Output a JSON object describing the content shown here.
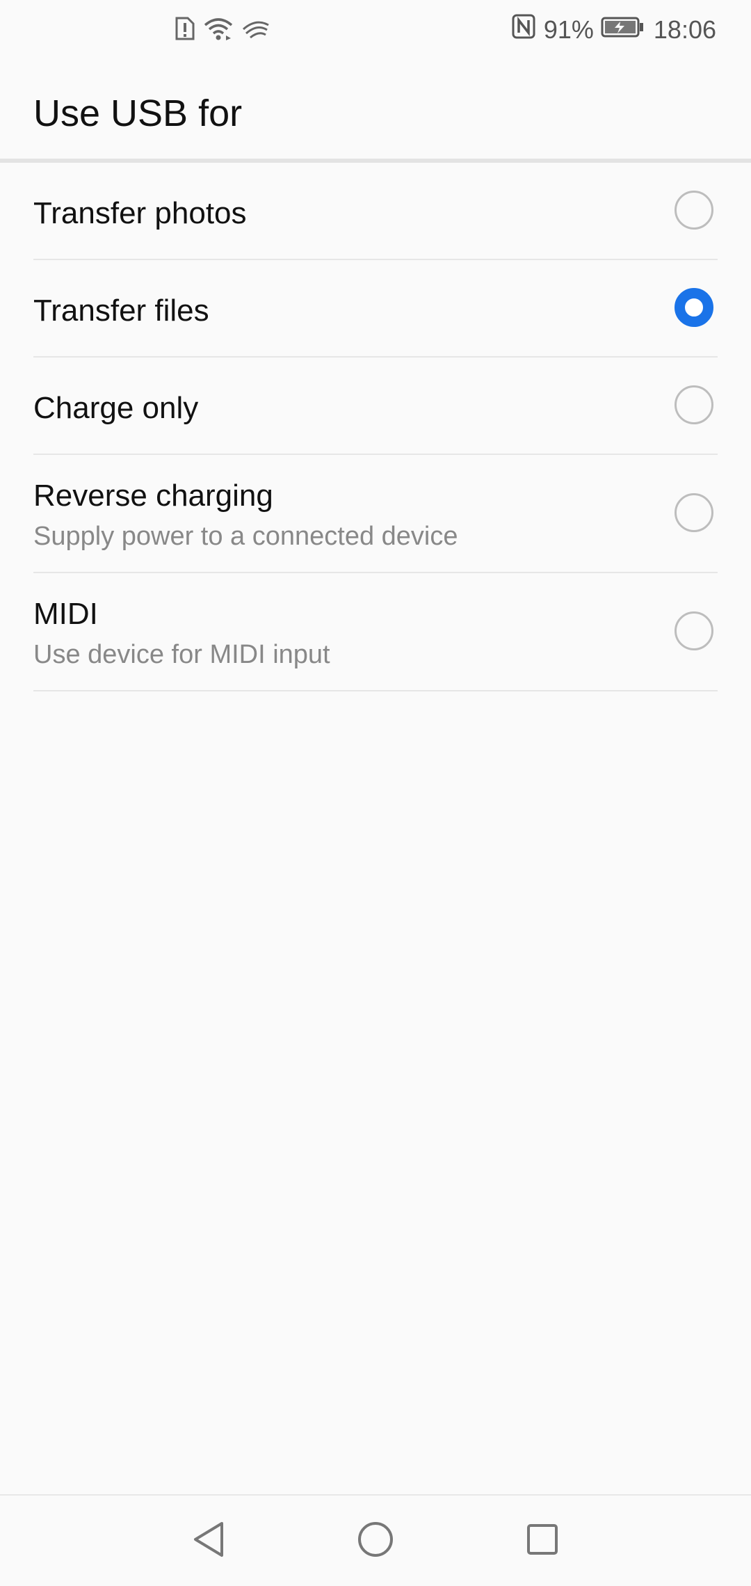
{
  "status_bar": {
    "nfc_icon": "nfc-icon",
    "battery_percent": "91%",
    "time": "18:06",
    "left_icons": [
      "sim-alert-icon",
      "wifi-icon",
      "swipe-app-icon"
    ]
  },
  "header": {
    "title": "Use USB for"
  },
  "options": [
    {
      "label": "Transfer photos",
      "selected": false
    },
    {
      "label": "Transfer files",
      "selected": true
    },
    {
      "label": "Charge only",
      "selected": false
    },
    {
      "label": "Reverse charging",
      "subtitle": "Supply power to a connected device",
      "selected": false
    },
    {
      "label": "MIDI",
      "subtitle": "Use device for MIDI input",
      "selected": false
    }
  ],
  "nav": {
    "icons": [
      "back-icon",
      "home-icon",
      "recents-icon"
    ]
  },
  "colors": {
    "accent": "#1a73e8",
    "background": "#fafafa",
    "divider": "#e6e6e6"
  }
}
